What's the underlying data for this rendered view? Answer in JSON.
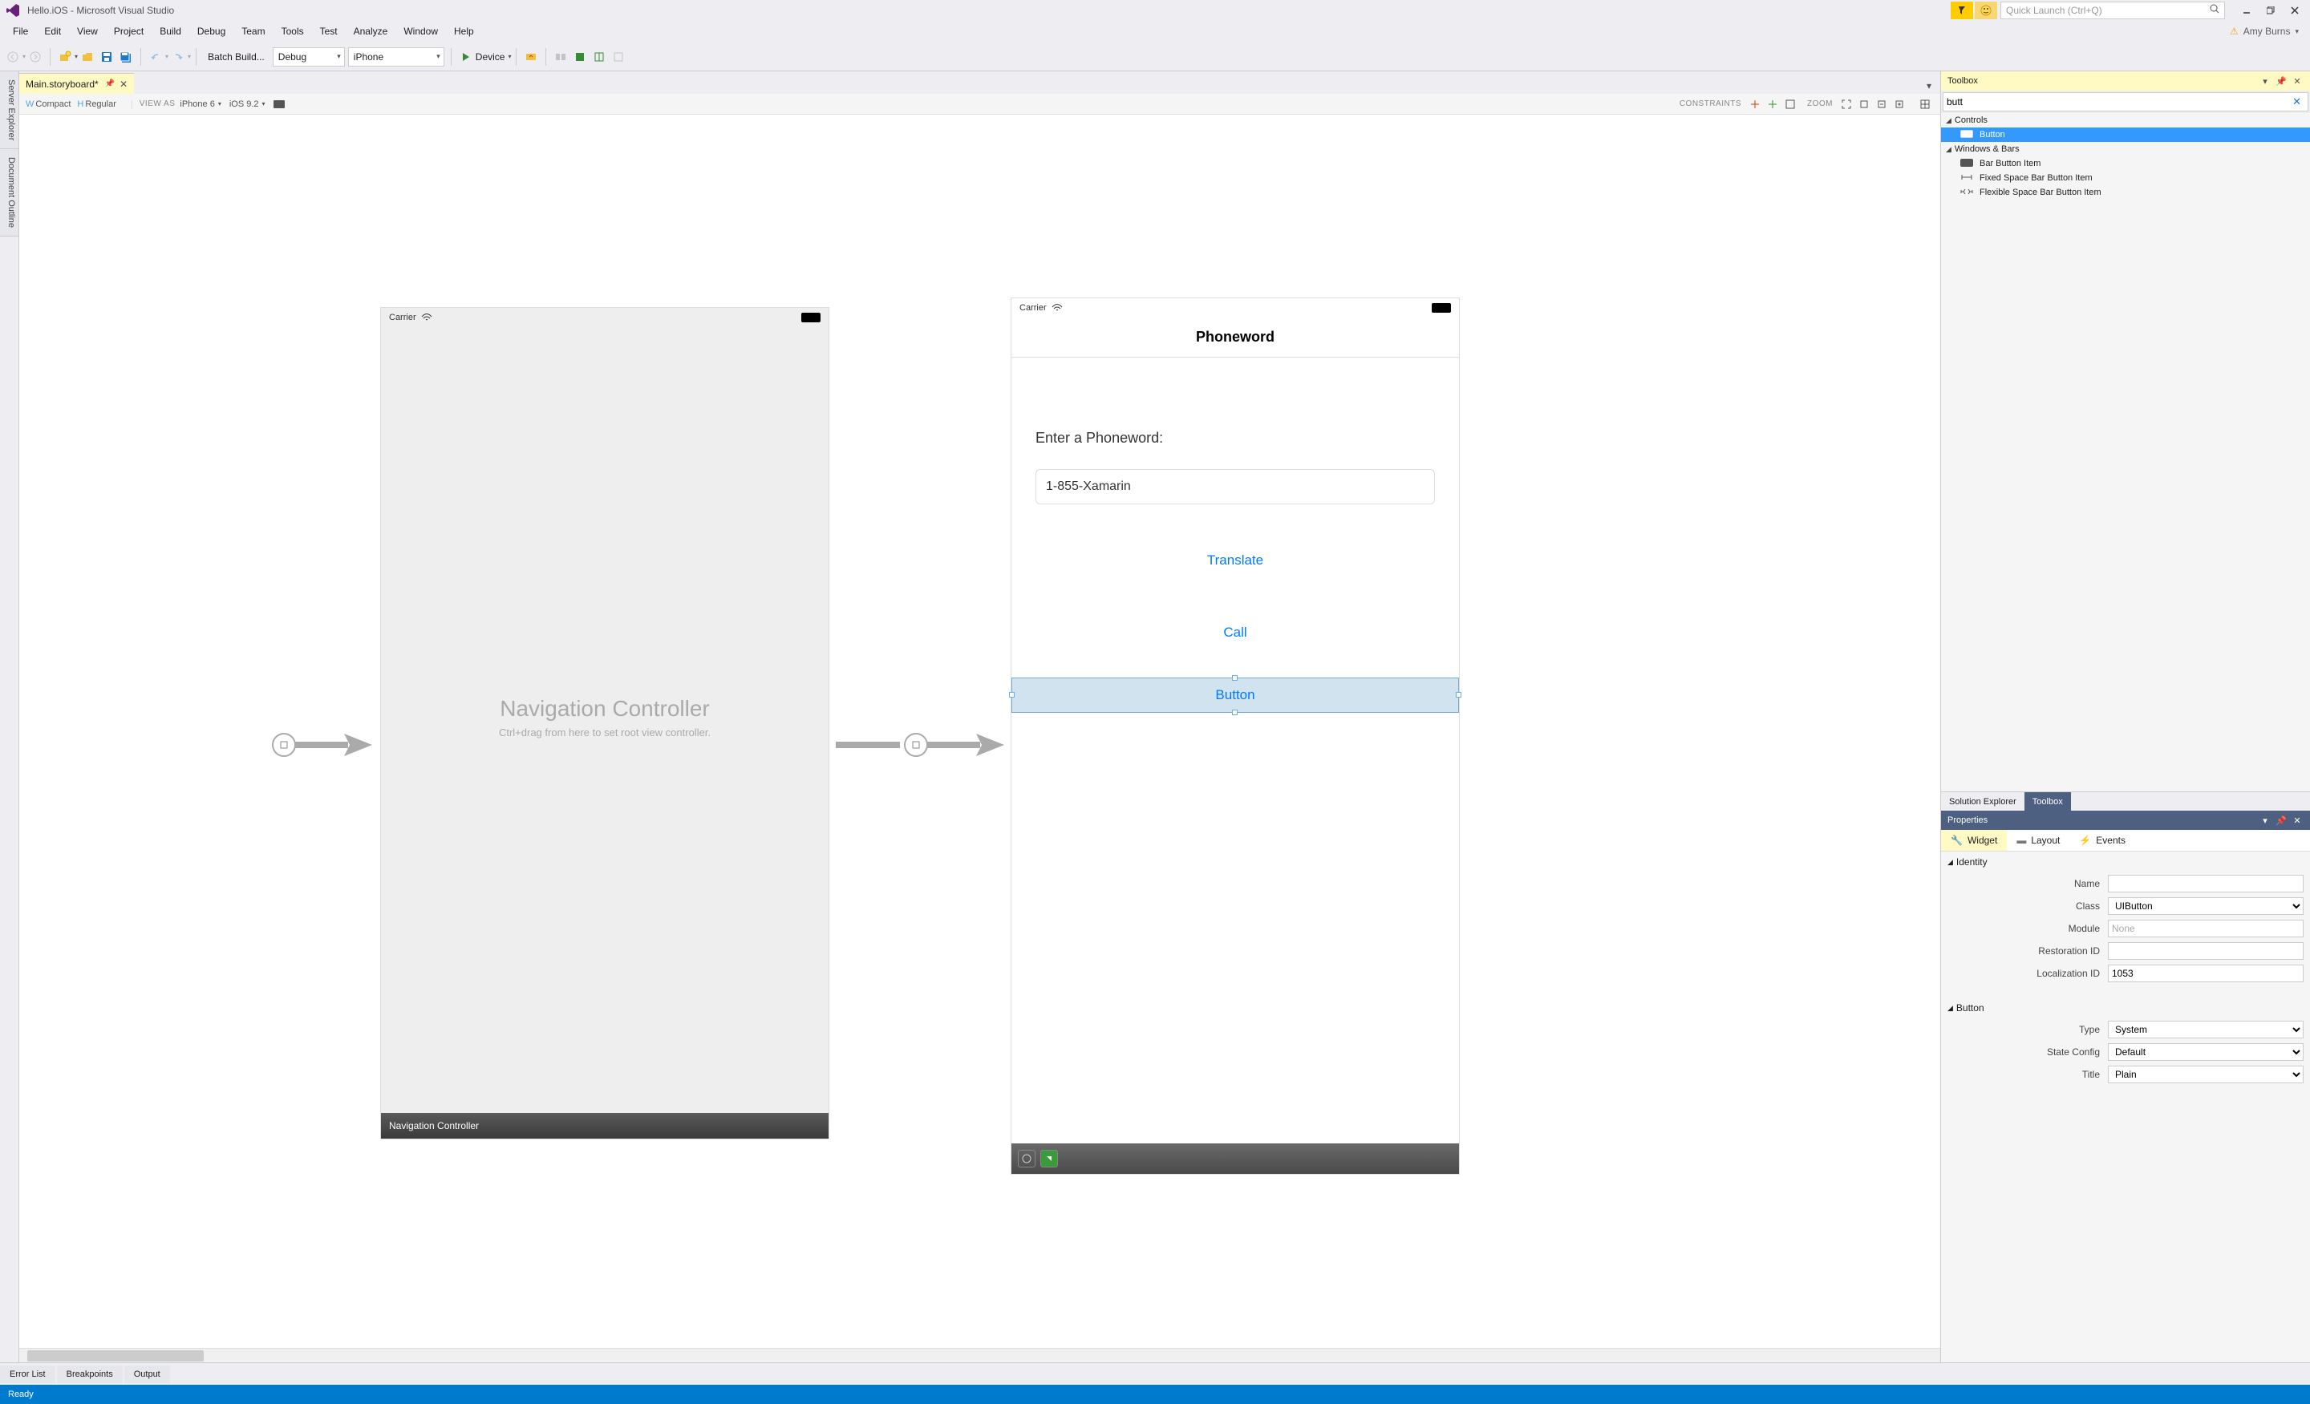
{
  "titlebar": {
    "title": "Hello.iOS - Microsoft Visual Studio",
    "quicklaunch_placeholder": "Quick Launch (Ctrl+Q)"
  },
  "menu": {
    "items": [
      "File",
      "Edit",
      "View",
      "Project",
      "Build",
      "Debug",
      "Team",
      "Tools",
      "Test",
      "Analyze",
      "Window",
      "Help"
    ],
    "user": "Amy Burns"
  },
  "toolbar": {
    "batch_build": "Batch Build...",
    "config": "Debug",
    "platform": "iPhone",
    "device": "Device"
  },
  "doc_tab": {
    "name": "Main.storyboard*"
  },
  "designer_toolbar": {
    "w_label": "W",
    "w_value": "Compact",
    "h_label": "H",
    "h_value": "Regular",
    "viewas_label": "VIEW AS",
    "device": "iPhone 6",
    "ios": "iOS 9.2",
    "constraints_label": "CONSTRAINTS",
    "zoom_label": "ZOOM"
  },
  "side_tabs": [
    "Server Explorer",
    "Document Outline"
  ],
  "canvas": {
    "nav": {
      "carrier": "Carrier",
      "title": "Navigation Controller",
      "subtitle": "Ctrl+drag from here to set root view controller.",
      "footer": "Navigation Controller"
    },
    "phoneword": {
      "carrier": "Carrier",
      "header": "Phoneword",
      "label": "Enter a Phoneword:",
      "textfield_value": "1-855-Xamarin",
      "translate": "Translate",
      "call": "Call",
      "button": "Button"
    }
  },
  "toolbox": {
    "title": "Toolbox",
    "search_value": "butt",
    "groups": [
      {
        "name": "Controls",
        "items": [
          {
            "label": "Button",
            "selected": true
          }
        ]
      },
      {
        "name": "Windows & Bars",
        "items": [
          {
            "label": "Bar Button Item"
          },
          {
            "label": "Fixed Space Bar Button Item"
          },
          {
            "label": "Flexible Space Bar Button Item"
          }
        ]
      }
    ],
    "panel_tabs": [
      "Solution Explorer",
      "Toolbox"
    ],
    "active_panel_tab": "Toolbox"
  },
  "properties": {
    "title": "Properties",
    "tabs": [
      "Widget",
      "Layout",
      "Events"
    ],
    "active_tab": "Widget",
    "identity": {
      "header": "Identity",
      "name": "",
      "class_placeholder": "UIButton",
      "module_placeholder": "None",
      "restoration_id": "",
      "localization_id": "1053",
      "labels": {
        "name": "Name",
        "class": "Class",
        "module": "Module",
        "restoration_id": "Restoration ID",
        "localization_id": "Localization ID"
      }
    },
    "button": {
      "header": "Button",
      "type": "System",
      "state_config": "Default",
      "title": "Plain",
      "labels": {
        "type": "Type",
        "state_config": "State Config",
        "title": "Title"
      }
    }
  },
  "bottom": {
    "tabs": [
      "Error List",
      "Breakpoints",
      "Output"
    ],
    "status": "Ready"
  }
}
